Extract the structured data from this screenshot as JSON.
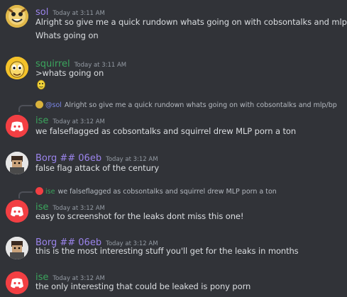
{
  "colors": {
    "background": "#313338",
    "sol": "#9b84ec",
    "squirrel": "#3ba55d",
    "ise": "#3ba55d",
    "borg": "#9b84ec",
    "discord_red": "#f23f43",
    "mention": "#7a86e6"
  },
  "messages": [
    {
      "author": "sol",
      "time": "Today at 3:11 AM",
      "lines": [
        "Alright so give me a quick rundown whats going on with cobsontalks and mlp/bp",
        "Whats going on"
      ]
    },
    {
      "author": "squirrel",
      "time": "Today at 3:11 AM",
      "lines": [
        ">whats going on"
      ],
      "attachment_icon": "yellow-face-emoji-icon"
    },
    {
      "reply": {
        "author": "@sol",
        "text": "Alright so give me a quick rundown whats going on with cobsontalks and mlp/bp"
      },
      "author": "ise",
      "time": "Today at 3:12 AM",
      "lines": [
        "we falseflagged as cobsontalks and squirrel drew MLP porn a ton"
      ]
    },
    {
      "author": "Borg ## 06eb",
      "time": "Today at 3:12 AM",
      "lines": [
        "false flag attack of the century"
      ]
    },
    {
      "reply": {
        "author": "ise",
        "text": "we falseflagged as cobsontalks and squirrel drew MLP porn a ton"
      },
      "author": "ise",
      "time": "Today at 3:12 AM",
      "lines": [
        "easy to screenshot for the leaks dont miss this one!"
      ]
    },
    {
      "author": "Borg ## 06eb",
      "time": "Today at 3:12 AM",
      "lines": [
        "this is the most interesting stuff you'll get for the leaks in months"
      ]
    },
    {
      "author": "ise",
      "time": "Today at 3:12 AM",
      "lines": [
        "the only interesting that could be leaked is pony porn"
      ]
    }
  ]
}
